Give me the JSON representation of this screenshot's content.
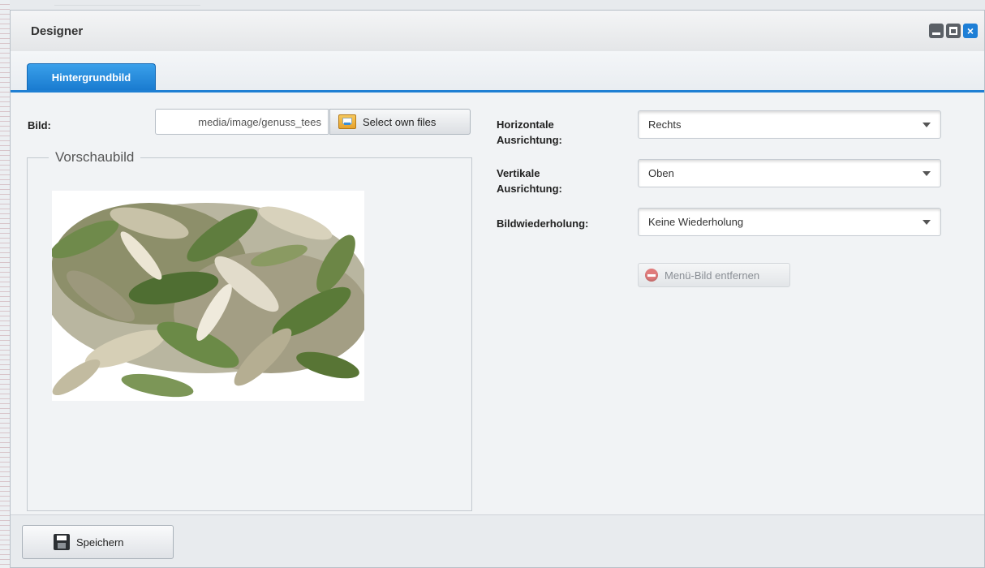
{
  "window": {
    "title": "Designer"
  },
  "tabs": [
    {
      "label": "Hintergrundbild",
      "active": true
    }
  ],
  "left": {
    "bild_label": "Bild:",
    "path_value": "media/image/genuss_tees",
    "select_files_label": "Select own files",
    "preview_legend": "Vorschaubild"
  },
  "right": {
    "horizontal_label": "Horizontale Ausrichtung:",
    "horizontal_value": "Rechts",
    "vertical_label": "Vertikale Ausrichtung:",
    "vertical_value": "Oben",
    "repeat_label": "Bildwiederholung:",
    "repeat_value": "Keine Wiederholung",
    "remove_label": "Menü-Bild entfernen"
  },
  "footer": {
    "save_label": "Speichern"
  },
  "colors": {
    "accent": "#1f7fd3",
    "close_button": "#1e7fd6",
    "tab_blue": "#2a8fe0"
  }
}
